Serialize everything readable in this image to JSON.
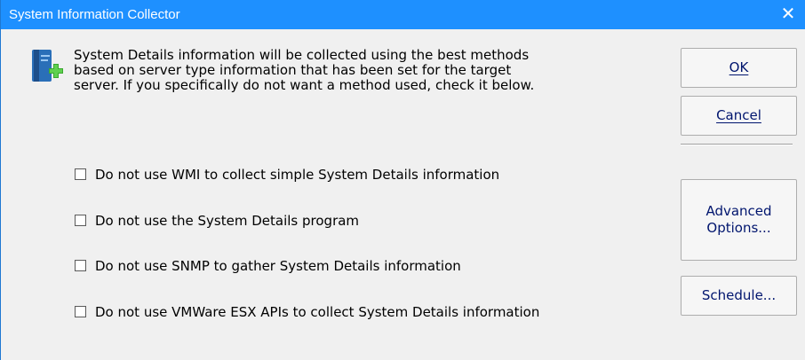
{
  "window": {
    "title": "System Information Collector",
    "close_glyph": "✕"
  },
  "icons": {
    "app_icon": "book-add-icon",
    "close": "close-icon"
  },
  "description": {
    "line1": "System Details information will be collected using the best methods",
    "line2": "based on server type information that has been set for the target",
    "line3": "server.  If you specifically do not want a method used, check it below."
  },
  "options": [
    {
      "label": "Do not use WMI to collect simple System Details information",
      "checked": false
    },
    {
      "label": "Do not use the System Details program",
      "checked": false
    },
    {
      "label": "Do not use SNMP to gather System Details information",
      "checked": false
    },
    {
      "label": "Do not use VMWare ESX APIs to collect System Details information",
      "checked": false
    }
  ],
  "buttons": {
    "ok": "OK",
    "cancel": "Cancel",
    "advanced_line1": "Advanced",
    "advanced_line2": "Options...",
    "schedule": "Schedule..."
  },
  "colors": {
    "titlebar": "#1e90ff",
    "window_bg": "#f0f0f0",
    "button_text": "#00156e"
  }
}
